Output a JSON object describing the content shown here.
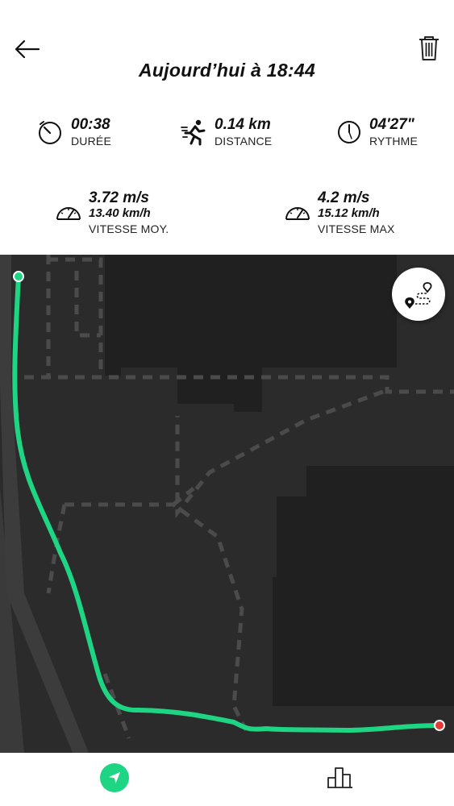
{
  "header": {
    "title": "Aujourd’hui à 18:44"
  },
  "stats": {
    "duration": {
      "value": "00:38",
      "label": "DURÉE",
      "icon": "stopwatch-icon"
    },
    "distance": {
      "value": "0.14 km",
      "label": "DISTANCE",
      "icon": "runner-icon"
    },
    "pace": {
      "value": "04'27\"",
      "label": "RYTHME",
      "icon": "clock-icon"
    },
    "avg_speed": {
      "value_ms": "3.72 m/s",
      "value_kmh": "13.40 km/h",
      "label": "VITESSE MOY.",
      "icon": "speedometer-icon"
    },
    "max_speed": {
      "value_ms": "4.2 m/s",
      "value_kmh": "15.12 km/h",
      "label": "VITESSE MAX",
      "icon": "speedometer-icon"
    }
  },
  "colors": {
    "route": "#1ed584",
    "map_background": "#2b2b2b",
    "end_marker": "#e53935"
  },
  "tabs": [
    {
      "name": "navigation",
      "icon": "navigation-arrow-icon",
      "active": true
    },
    {
      "name": "statistics",
      "icon": "bar-chart-icon",
      "active": false
    }
  ]
}
